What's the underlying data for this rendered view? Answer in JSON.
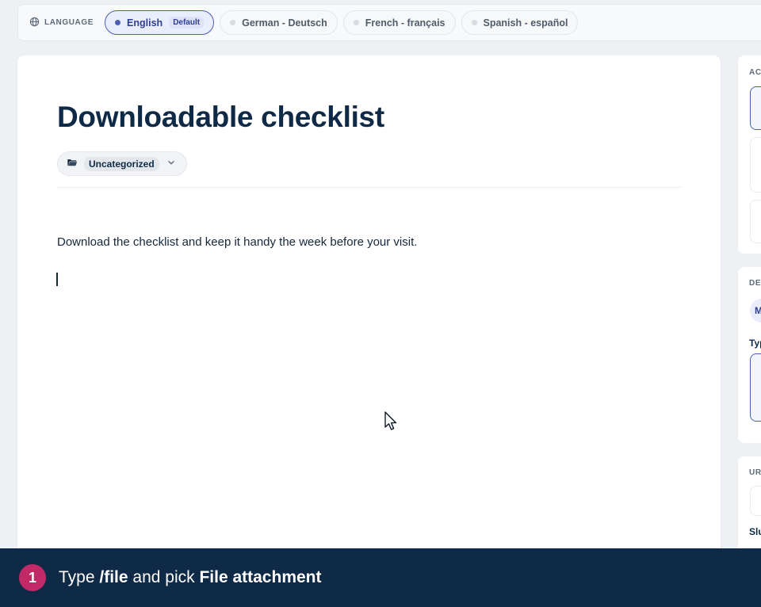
{
  "language_bar": {
    "label": "LANGUAGE",
    "languages": [
      {
        "name": "English",
        "badge": "Default",
        "active": true
      },
      {
        "name": "German - Deutsch",
        "active": false
      },
      {
        "name": "French - français",
        "active": false
      },
      {
        "name": "Spanish - español",
        "active": false
      }
    ]
  },
  "editor": {
    "title": "Downloadable checklist",
    "category": "Uncategorized",
    "body": "Download the checklist and keep it handy the week before your visit."
  },
  "sidebar": {
    "section1_label": "AC",
    "section2_label": "DE",
    "section2_chip": "M",
    "section2_field_label": "Typ",
    "section3_label": "UR",
    "section3_field_label": "Slu"
  },
  "caption": {
    "step": "1",
    "prefix": "Type ",
    "command": "/file",
    "middle": " and pick ",
    "target": "File attachment"
  },
  "colors": {
    "accent": "#4a5fb4",
    "caption_bg": "#0f2a47",
    "step_badge": "#c22a67",
    "title": "#0e2a47"
  },
  "icons": [
    "globe-icon",
    "folder-icon",
    "chevron-down-icon",
    "mouse-pointer-icon"
  ]
}
